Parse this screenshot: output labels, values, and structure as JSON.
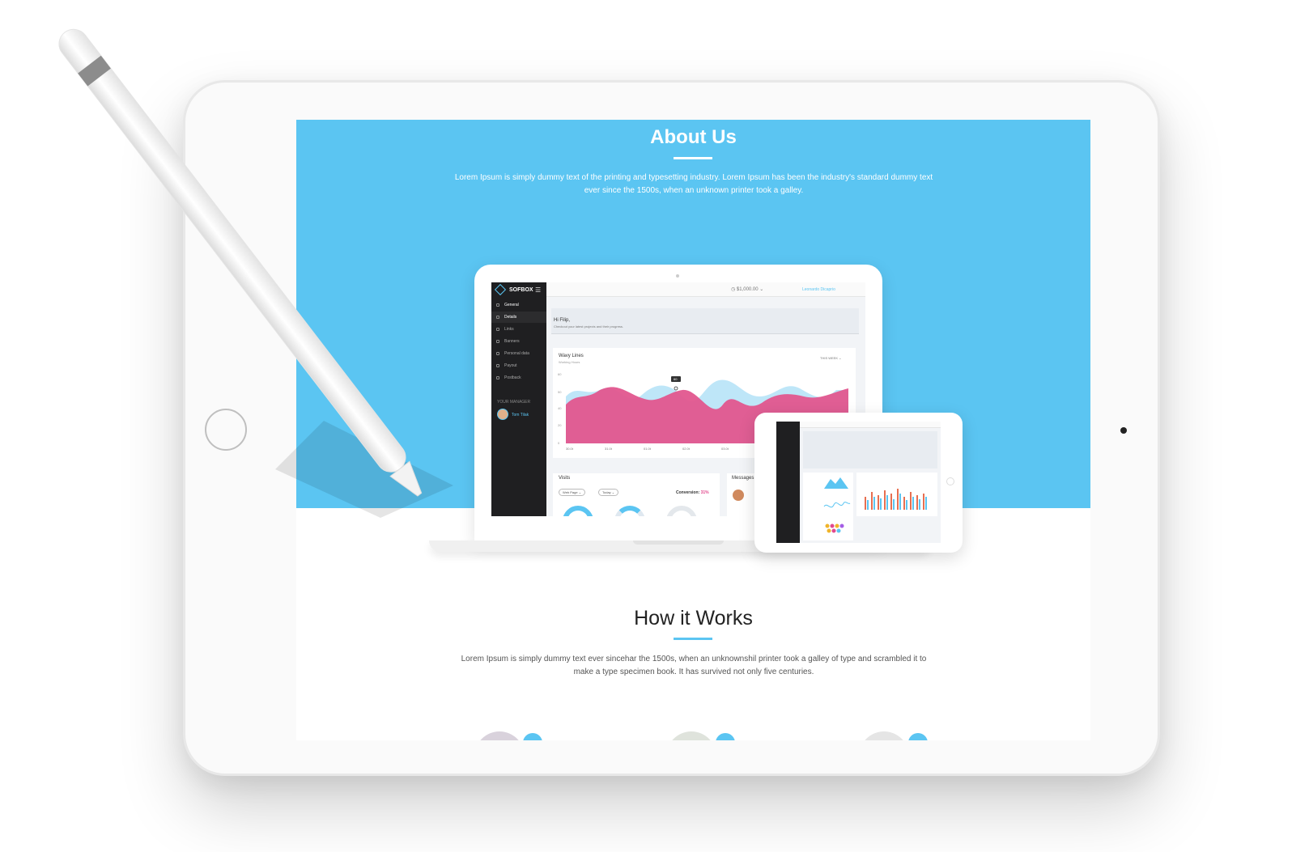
{
  "about": {
    "title": "About Us",
    "text": "Lorem Ipsum is simply dummy text of the printing and typesetting industry. Lorem Ipsum has been the industry's standard dummy text ever since the 1500s, when an unknown printer took a galley."
  },
  "how": {
    "title": "How it Works",
    "text": "Lorem Ipsum is simply dummy text ever sincehar the 1500s, when an unknownshil printer took a galley of type and scrambled it to make a type specimen book. It has survived not only five centuries."
  },
  "dashboard": {
    "brand": "SOFBOX",
    "sidebar": [
      "General",
      "Details",
      "Links",
      "Banners",
      "Personal data",
      "Payout",
      "Postback"
    ],
    "manager_label": "YOUR MANAGER",
    "manager_name": "Tom Tilak",
    "balance": "$1,000.00",
    "user": "Leonardo Dicaprio",
    "greeting": "Hi Filip,",
    "greeting_sub": "Checkout your latest projects and their progress.",
    "wavy": {
      "title": "Wavy Lines",
      "sub": "Working Hours",
      "range": "THIS WEEK",
      "tooltip": "60",
      "y_ticks": [
        "60",
        "50",
        "40",
        "20",
        "0"
      ],
      "x_ticks": [
        "30.0t",
        "31.0t",
        "01.0t",
        "02.0t",
        "03.0t",
        "04.0t",
        "05.0t",
        "06.0t"
      ]
    },
    "visits": {
      "title": "Visits",
      "filter1": "Web Page",
      "filter2": "Today",
      "conversion_label": "Conversion:",
      "conversion_value": "31%"
    },
    "messages_title": "Messages"
  },
  "colors": {
    "accent": "#5bc5f2",
    "pink": "#e14a8e",
    "dark": "#1f1f21"
  }
}
